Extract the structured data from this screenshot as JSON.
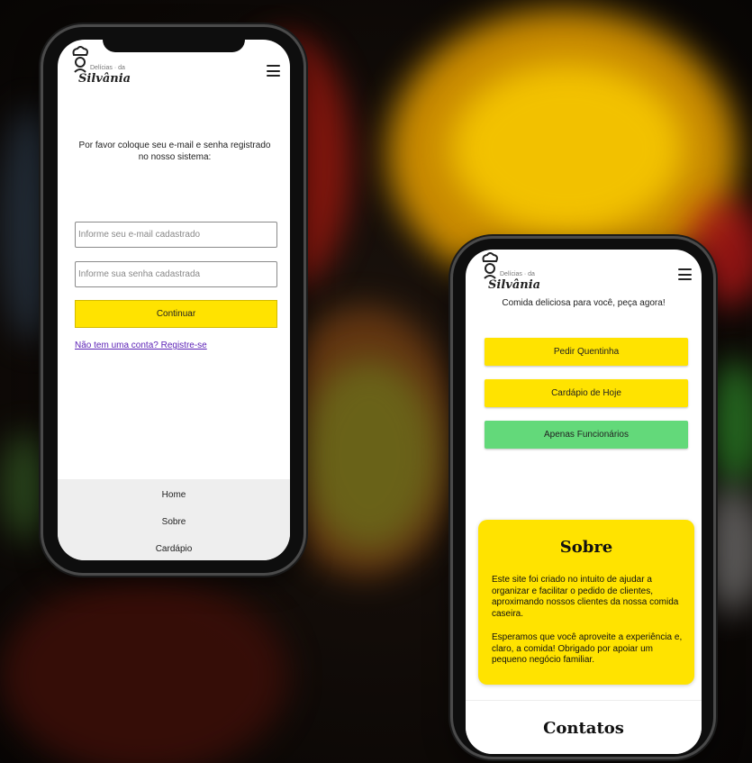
{
  "left_phone": {
    "logo": {
      "small": "Delícias · da",
      "brand": "Silvânia"
    },
    "prompt": "Por favor coloque seu e-mail e senha registrado no nosso sistema:",
    "email_placeholder": "Informe seu e-mail cadastrado",
    "password_placeholder": "Informe sua senha cadastrada",
    "continue_label": "Continuar",
    "register_link": "Não tem uma conta? Registre-se",
    "footer": {
      "home": "Home",
      "about": "Sobre",
      "menu": "Cardápio"
    }
  },
  "right_phone": {
    "logo": {
      "small": "Delícias · da",
      "brand": "Silvânia"
    },
    "tagline": "Comida deliciosa para você, peça agora!",
    "buttons": {
      "order": "Pedir Quentinha",
      "today_menu": "Cardápio de Hoje",
      "employees": "Apenas Funcionários"
    },
    "about": {
      "title": "Sobre",
      "p1": "Este site foi criado no intuito de ajudar a organizar e facilitar o pedido de clientes, aproximando nossos clientes da nossa comida caseira.",
      "p2": "Esperamos que você aproveite a experiência e, claro, a comida! Obrigado por apoiar um pequeno negócio familiar."
    },
    "contacts_title": "Contatos"
  },
  "colors": {
    "yellow": "#ffe300",
    "green": "#63d97a",
    "link": "#5a1fb5"
  }
}
